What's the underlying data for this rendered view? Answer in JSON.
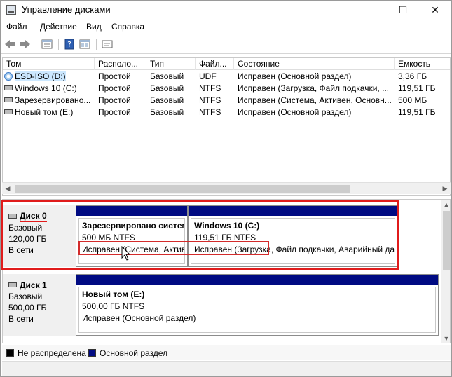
{
  "window": {
    "title": "Управление дисками",
    "controls": {
      "minimize": "—",
      "maximize": "☐",
      "close": "✕"
    }
  },
  "menu": [
    "Файл",
    "Действие",
    "Вид",
    "Справка"
  ],
  "toolbar": {
    "icons": [
      "back-icon",
      "forward-icon",
      "properties-icon",
      "help-icon",
      "console-icon",
      "refresh-icon"
    ]
  },
  "volume_list": {
    "columns": [
      "Том",
      "Располо...",
      "Тип",
      "Файл...",
      "Состояние",
      "Емкость"
    ],
    "rows": [
      {
        "icon": "disc-icon",
        "name": "ESD-ISO (D:)",
        "layout": "Простой",
        "type": "Базовый",
        "fs": "UDF",
        "status": "Исправен (Основной раздел)",
        "capacity": "3,36 ГБ",
        "selected": true
      },
      {
        "icon": "drive-icon",
        "name": "Windows 10 (C:)",
        "layout": "Простой",
        "type": "Базовый",
        "fs": "NTFS",
        "status": "Исправен (Загрузка, Файл подкачки, ...",
        "capacity": "119,51 ГБ",
        "selected": false
      },
      {
        "icon": "drive-icon",
        "name": "Зарезервировано...",
        "layout": "Простой",
        "type": "Базовый",
        "fs": "NTFS",
        "status": "Исправен (Система, Активен, Основн...",
        "capacity": "500 МБ",
        "selected": false
      },
      {
        "icon": "drive-icon",
        "name": "Новый том (E:)",
        "layout": "Простой",
        "type": "Базовый",
        "fs": "NTFS",
        "status": "Исправен (Основной раздел)",
        "capacity": "119,51 ГБ",
        "selected": false
      }
    ]
  },
  "disks": [
    {
      "name": "Диск 0",
      "type": "Базовый",
      "size": "120,00 ГБ",
      "state": "В сети",
      "partitions": [
        {
          "name": "Зарезервировано систем",
          "size": "500 МБ NTFS",
          "status": "Исправен (Система, Активен, Основной раздел)"
        },
        {
          "name": "Windows 10  (C:)",
          "size": "119,51 ГБ NTFS",
          "status": "Исправен (Загрузка, Файл подкачки, Аварийный дамп"
        }
      ]
    },
    {
      "name": "Диск 1",
      "type": "Базовый",
      "size": "500,00 ГБ",
      "state": "В сети",
      "partitions": [
        {
          "name": "Новый том  (E:)",
          "size": "500,00 ГБ NTFS",
          "status": "Исправен (Основной раздел)"
        }
      ]
    }
  ],
  "legend": [
    {
      "label": "Не распределена",
      "color": "#000000"
    },
    {
      "label": "Основной раздел",
      "color": "#000a82"
    }
  ]
}
